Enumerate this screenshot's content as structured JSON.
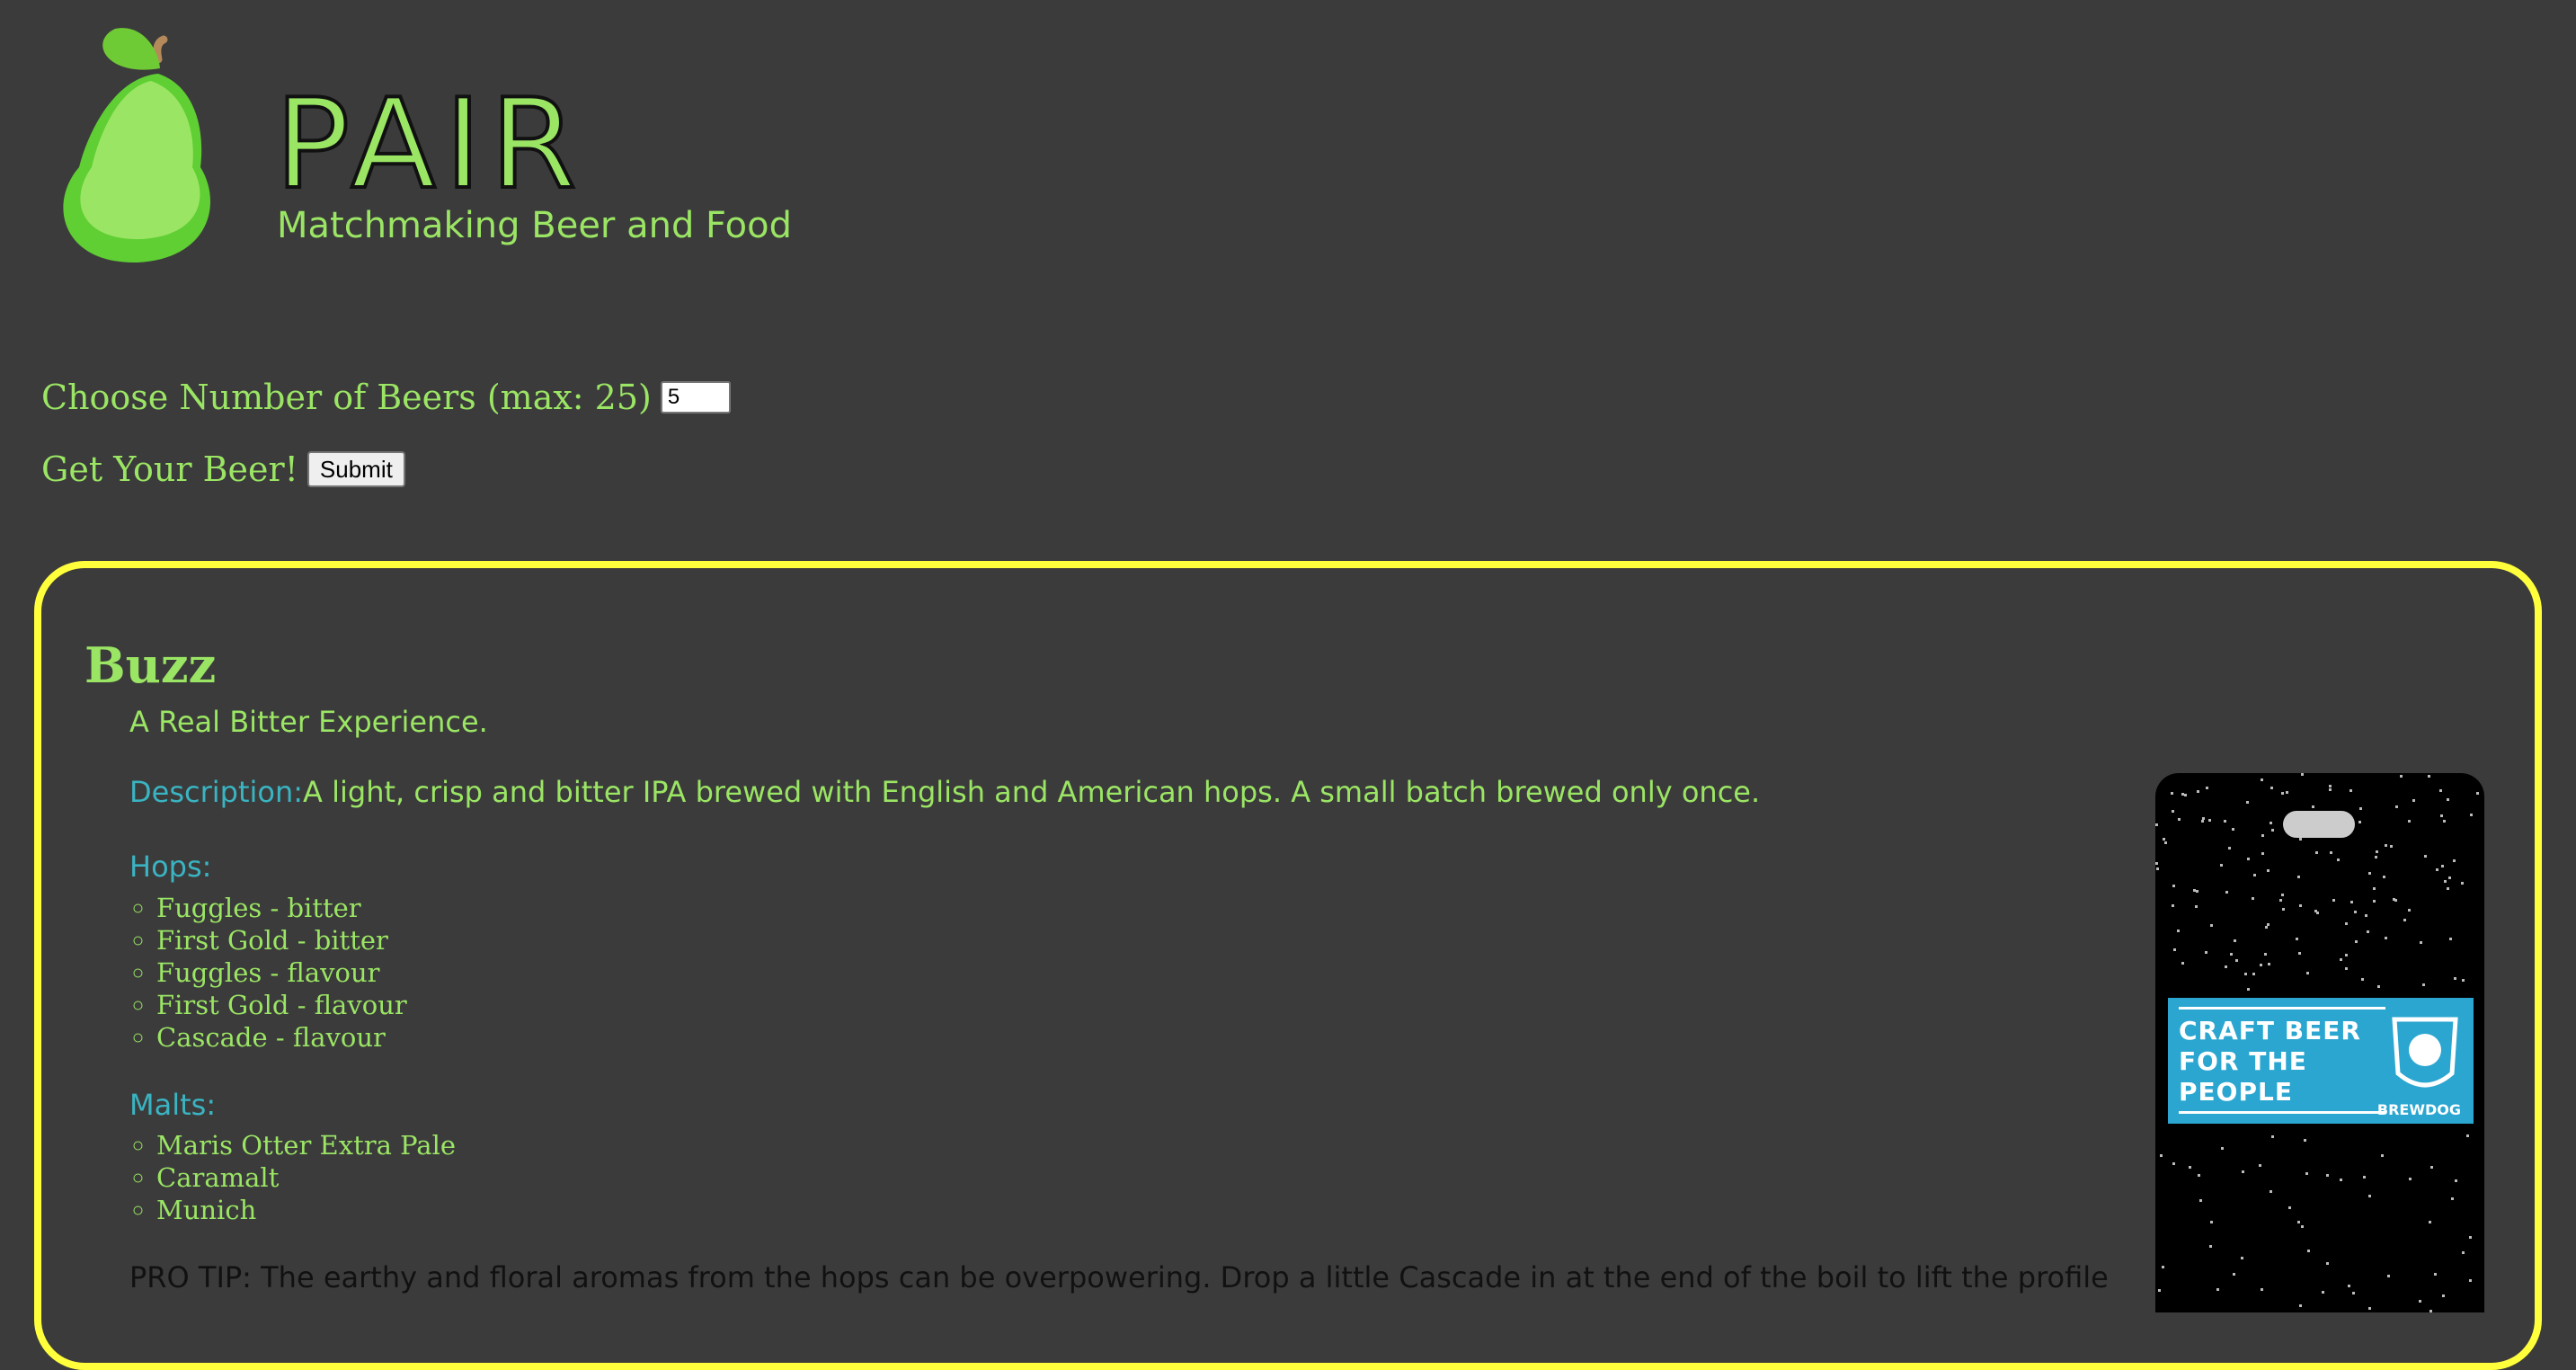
{
  "header": {
    "logo_name": "pear-logo",
    "title": "PAIR",
    "tagline": "Matchmaking Beer and Food"
  },
  "form": {
    "count_label": "Choose Number of Beers (max: 25)",
    "count_value": "5",
    "submit_label": "Get Your Beer!",
    "submit_button": "Submit"
  },
  "beer": {
    "name": "Buzz",
    "tagline": "A Real Bitter Experience.",
    "description_label": "Description:",
    "description": "A light, crisp and bitter IPA brewed with English and American hops. A small batch brewed only once.",
    "hops_label": "Hops:",
    "hops": [
      "Fuggles - bitter",
      "First Gold - bitter",
      "Fuggles - flavour",
      "First Gold - flavour",
      "Cascade - flavour"
    ],
    "malts_label": "Malts:",
    "malts": [
      "Maris Otter Extra Pale",
      "Caramalt",
      "Munich"
    ],
    "pro_tip": "PRO TIP: The earthy and floral aromas from the hops can be overpowering. Drop a little Cascade in at the end of the boil to lift the profile",
    "image": {
      "label_lines": [
        "CRAFT BEER",
        "FOR THE",
        "PEOPLE"
      ],
      "brand": "BREWDOG"
    }
  },
  "colors": {
    "background": "#3b3b3b",
    "accent_green": "#9be564",
    "heading_teal": "#3ab4c2",
    "card_border": "#ffff3c"
  }
}
